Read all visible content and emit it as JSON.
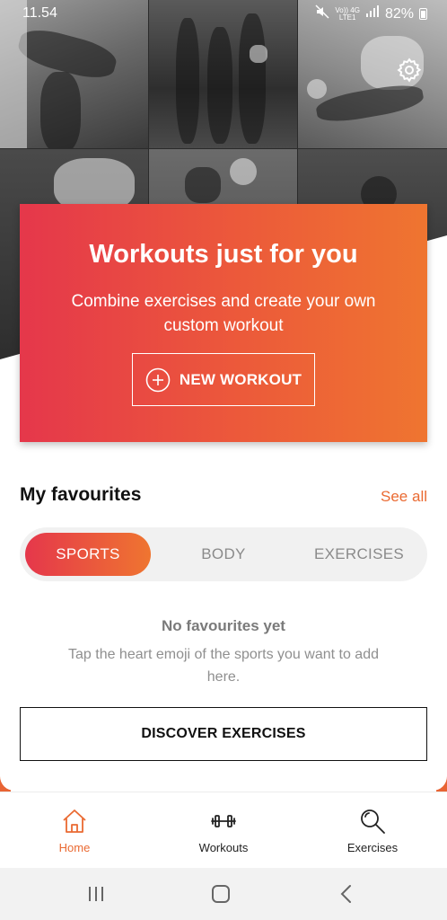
{
  "status_bar": {
    "time": "11.54",
    "network_top": "Vo)) 4G",
    "network_bottom": "LTE1",
    "battery": "82%"
  },
  "hero": {
    "settings_icon": "gear-icon"
  },
  "promo": {
    "title": "Workouts just for you",
    "text": "Combine exercises and create your own custom workout",
    "button_label": "NEW WORKOUT",
    "button_icon": "plus-circle-icon"
  },
  "favourites": {
    "title": "My favourites",
    "see_all": "See all",
    "tabs": [
      {
        "label": "SPORTS",
        "active": true
      },
      {
        "label": "BODY",
        "active": false
      },
      {
        "label": "EXERCISES",
        "active": false
      }
    ],
    "empty_title": "No favourites yet",
    "empty_text": "Tap the heart emoji of the sports you want to add here.",
    "discover_button": "DISCOVER EXERCISES"
  },
  "bottom_nav": {
    "items": [
      {
        "label": "Home",
        "icon": "home-icon",
        "active": true
      },
      {
        "label": "Workouts",
        "icon": "dumbbell-icon",
        "active": false
      },
      {
        "label": "Exercises",
        "icon": "search-icon",
        "active": false
      }
    ]
  },
  "colors": {
    "accent_start": "#e5374b",
    "accent_end": "#ef7530",
    "link": "#ea6a32"
  }
}
